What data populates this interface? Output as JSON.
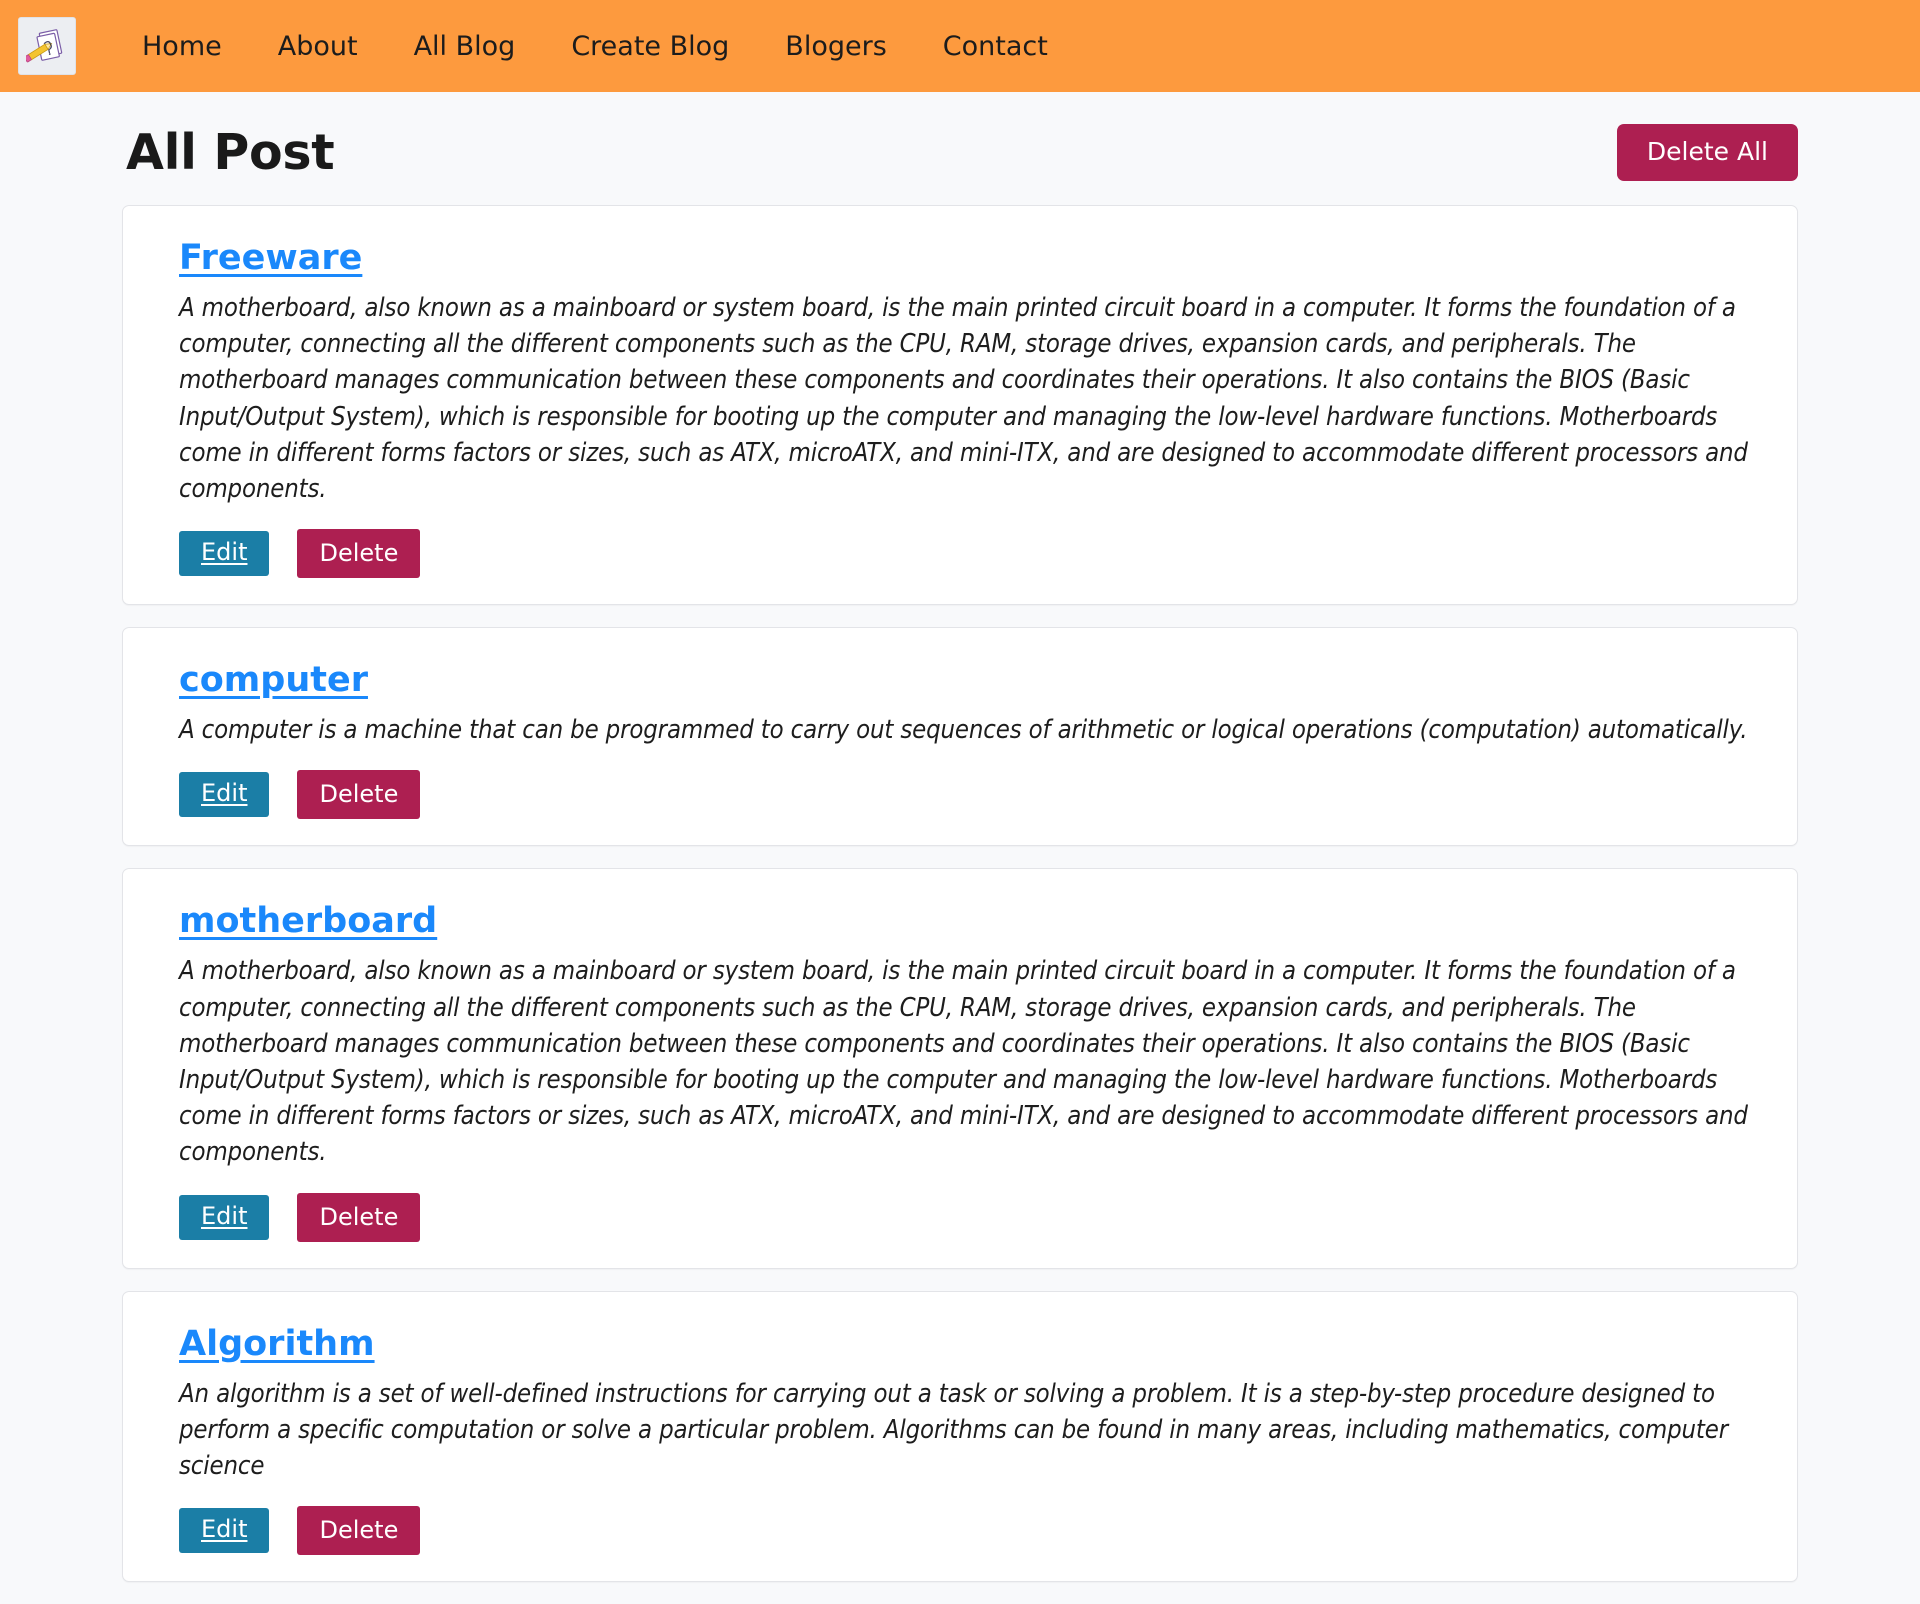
{
  "colors": {
    "navbar_bg": "#fd9a3e",
    "page_bg": "#f8f9fb",
    "card_bg": "#ffffff",
    "link_blue": "#1a88fb",
    "edit_teal": "#1b7ea6",
    "delete_crimson": "#ad1f51",
    "title_text": "#1a1a1a"
  },
  "navbar": {
    "logo_icon": "pencil-writing-on-notes-icon",
    "links": [
      {
        "label": "Home"
      },
      {
        "label": "About"
      },
      {
        "label": "All Blog"
      },
      {
        "label": "Create Blog"
      },
      {
        "label": "Blogers"
      },
      {
        "label": "Contact"
      }
    ]
  },
  "page": {
    "title": "All Post",
    "delete_all_label": "Delete All"
  },
  "actions": {
    "edit_label": "Edit",
    "delete_label": "Delete"
  },
  "posts": [
    {
      "title": "Freeware",
      "body": "A motherboard, also known as a mainboard or system board, is the main printed circuit board in a computer. It forms the foundation of a computer, connecting all the different components such as the CPU, RAM, storage drives, expansion cards, and peripherals. The motherboard manages communication between these components and coordinates their operations. It also contains the BIOS (Basic Input/Output System), which is responsible for booting up the computer and managing the low-level hardware functions. Motherboards come in different forms factors or sizes, such as ATX, microATX, and mini-ITX, and are designed to accommodate different processors and components."
    },
    {
      "title": "computer",
      "body": "A computer is a machine that can be programmed to carry out sequences of arithmetic or logical operations (computation) automatically."
    },
    {
      "title": "motherboard",
      "body": "A motherboard, also known as a mainboard or system board, is the main printed circuit board in a computer. It forms the foundation of a computer, connecting all the different components such as the CPU, RAM, storage drives, expansion cards, and peripherals. The motherboard manages communication between these components and coordinates their operations. It also contains the BIOS (Basic Input/Output System), which is responsible for booting up the computer and managing the low-level hardware functions. Motherboards come in different forms factors or sizes, such as ATX, microATX, and mini-ITX, and are designed to accommodate different processors and components."
    },
    {
      "title": "Algorithm",
      "body": "An algorithm is a set of well-defined instructions for carrying out a task or solving a problem. It is a step-by-step procedure designed to perform a specific computation or solve a particular problem. Algorithms can be found in many areas, including mathematics, computer science"
    }
  ]
}
